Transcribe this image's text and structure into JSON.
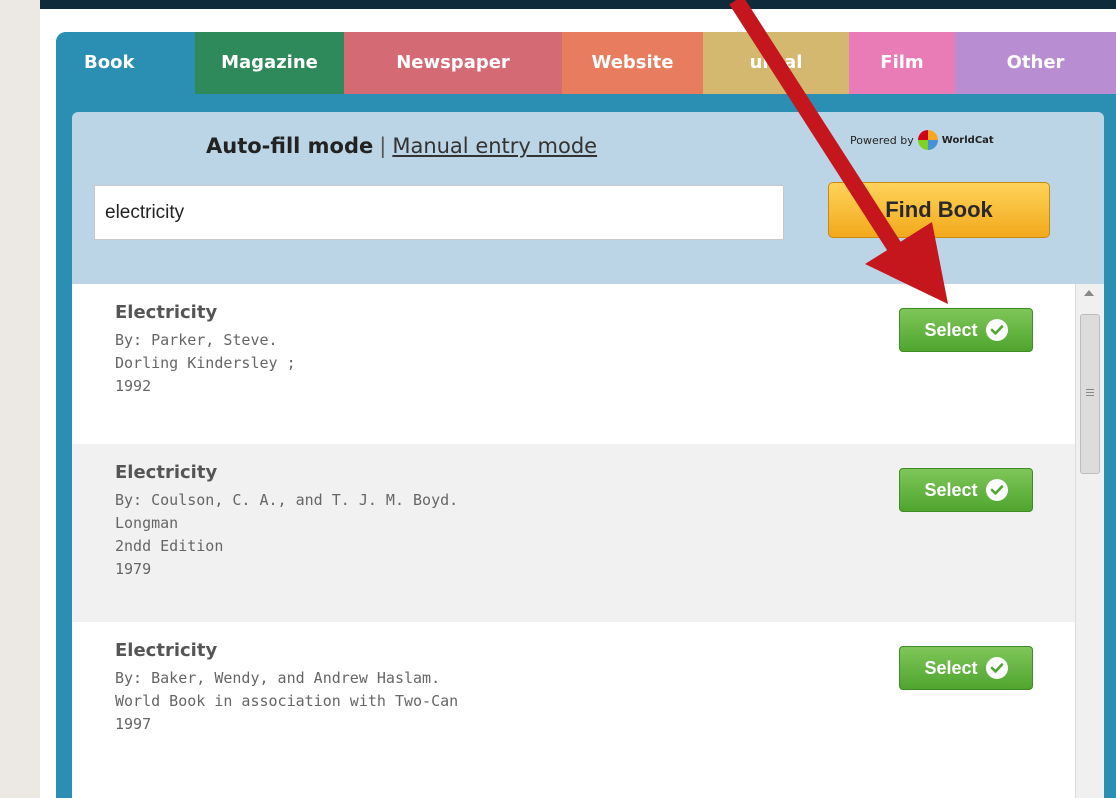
{
  "tabs": [
    {
      "label": "Book"
    },
    {
      "label": "Magazine"
    },
    {
      "label": "Newspaper"
    },
    {
      "label": "Website"
    },
    {
      "label": "urnal"
    },
    {
      "label": "Film"
    },
    {
      "label": "Other"
    }
  ],
  "modes": {
    "auto_label": "Auto-fill mode",
    "separator": "|",
    "manual_label": "Manual entry mode"
  },
  "powered_by": {
    "label": "Powered by",
    "brand": "WorldCat"
  },
  "search": {
    "value": "electricity",
    "button_label": "Find Book"
  },
  "results": [
    {
      "title": "Electricity",
      "lines": [
        "By: Parker, Steve.",
        "Dorling Kindersley ;",
        "1992"
      ],
      "select_label": "Select"
    },
    {
      "title": "Electricity",
      "lines": [
        "By: Coulson, C. A., and T. J. M. Boyd.",
        "Longman",
        "2ndd Edition",
        "1979"
      ],
      "select_label": "Select"
    },
    {
      "title": "Electricity",
      "lines": [
        "By: Baker, Wendy, and Andrew Haslam.",
        "World Book in association with Two-Can",
        "1997"
      ],
      "select_label": "Select"
    }
  ],
  "colors": {
    "arrow": "#c4161c",
    "select_green": "#5cb43a",
    "find_yellow": "#f5b52e",
    "widget_blue": "#2b8fb4"
  }
}
